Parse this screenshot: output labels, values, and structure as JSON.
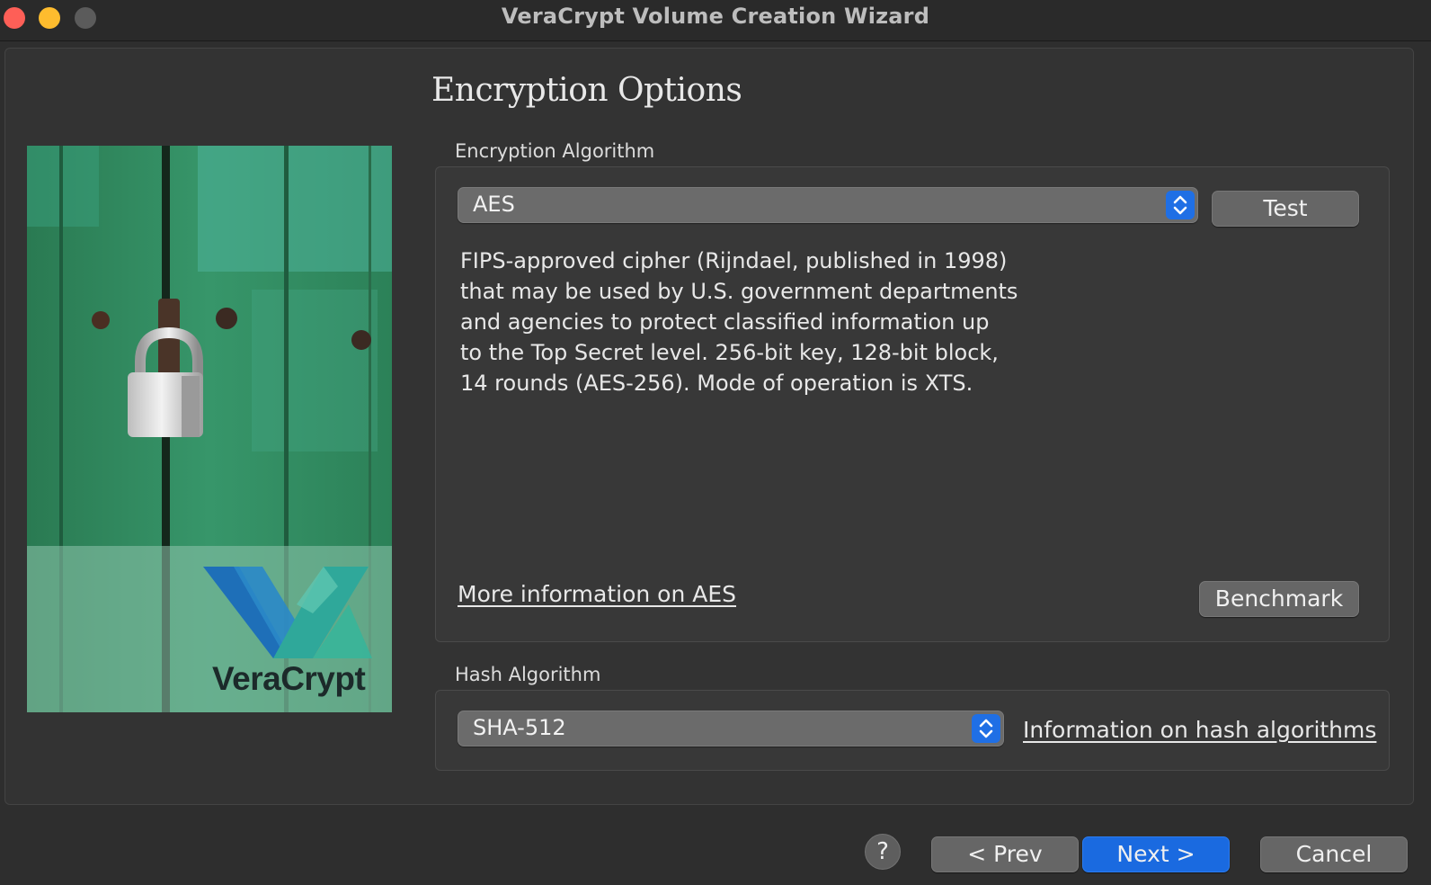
{
  "window": {
    "title": "VeraCrypt Volume Creation Wizard"
  },
  "page": {
    "title": "Encryption Options"
  },
  "brand": {
    "wordmark": "VeraCrypt",
    "colors": {
      "door_green": "#2f8a5e",
      "logo_blue": "#1e6fb8",
      "logo_teal": "#2fa89a"
    }
  },
  "encryption": {
    "label": "Encryption Algorithm",
    "selected": "AES",
    "test_label": "Test",
    "description_lines": [
      "FIPS-approved cipher (Rijndael, published in 1998)",
      "that may be used by U.S. government departments",
      "and agencies to protect classified information up",
      "to the Top Secret level. 256-bit key, 128-bit block,",
      "14 rounds (AES-256). Mode of operation is XTS."
    ],
    "more_info_link": "More information on AES",
    "benchmark_label": "Benchmark"
  },
  "hash": {
    "label": "Hash Algorithm",
    "selected": "SHA-512",
    "info_link": "Information on hash algorithms"
  },
  "footer": {
    "help_label": "?",
    "prev_label": "< Prev",
    "next_label": "Next >",
    "cancel_label": "Cancel"
  },
  "icons": {
    "popup_arrows": "chevron-up-down-icon",
    "padlock": "padlock-icon"
  },
  "accent": "#1a6ae0"
}
